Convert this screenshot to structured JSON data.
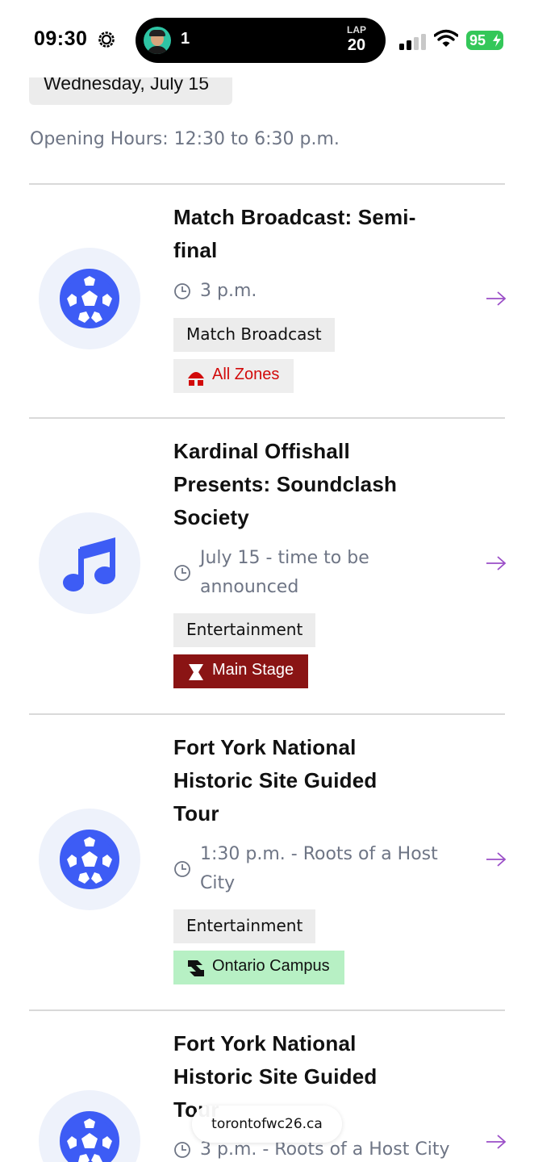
{
  "status_bar": {
    "time": "09:30",
    "island_count": "1",
    "lap_label": "LAP",
    "lap_number": "20",
    "battery": "95"
  },
  "header": {
    "date": "Wednesday, July 15",
    "opening_hours": "Opening Hours: 12:30 to 6:30 p.m."
  },
  "events": [
    {
      "icon": "soccer-ball-icon",
      "title_lines": [
        "Match Broadcast: Semi-",
        "final"
      ],
      "time_lines": [
        "3 p.m."
      ],
      "type": "Match Broadcast",
      "zone": "All Zones",
      "zone_color": "#d20a0a"
    },
    {
      "icon": "music-note-icon",
      "title_lines": [
        "Kardinal Offishall",
        "Presents: Soundclash",
        "Society"
      ],
      "time_lines": [
        "July 15 - time to be",
        "announced"
      ],
      "type": "Entertainment",
      "zone": "Main Stage",
      "zone_color": "#8a1414"
    },
    {
      "icon": "soccer-ball-icon",
      "title_lines": [
        "Fort York National",
        "Historic Site Guided",
        "Tour"
      ],
      "time_lines": [
        "1:30 p.m. - Roots of a Host",
        "City"
      ],
      "type": "Entertainment",
      "zone": "Ontario Campus",
      "zone_color": "#b7f0c4"
    },
    {
      "icon": "soccer-ball-icon",
      "title_lines": [
        "Fort York National",
        "Historic Site Guided",
        "Tour"
      ],
      "time_lines": [
        "3 p.m. - Roots of a Host City"
      ]
    }
  ],
  "url_bar": {
    "domain": "torontofwc26.ca"
  },
  "colors": {
    "accent_blue": "#3d5cf5",
    "icon_bg": "#eef2fb",
    "arrow_purple": "#9b4fc8",
    "muted_text": "#6e7585"
  }
}
